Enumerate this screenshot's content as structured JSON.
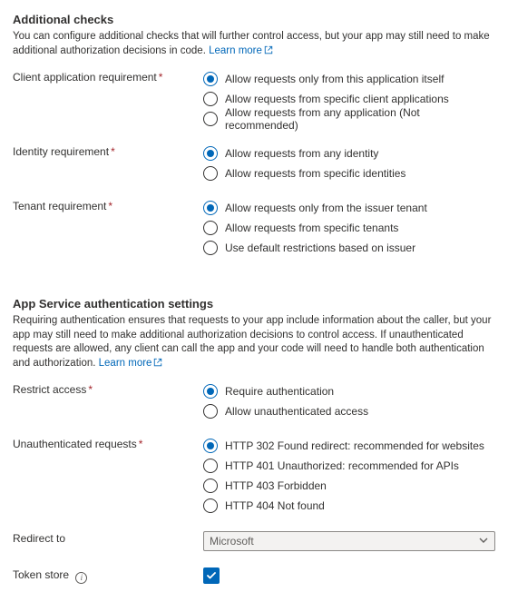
{
  "section1": {
    "title": "Additional checks",
    "desc": "You can configure additional checks that will further control access, but your app may still need to make additional authorization decisions in code.",
    "learn_more": "Learn more"
  },
  "client_req": {
    "label": "Client application requirement",
    "options": [
      "Allow requests only from this application itself",
      "Allow requests from specific client applications",
      "Allow requests from any application (Not recommended)"
    ]
  },
  "identity_req": {
    "label": "Identity requirement",
    "options": [
      "Allow requests from any identity",
      "Allow requests from specific identities"
    ]
  },
  "tenant_req": {
    "label": "Tenant requirement",
    "options": [
      "Allow requests only from the issuer tenant",
      "Allow requests from specific tenants",
      "Use default restrictions based on issuer"
    ]
  },
  "section2": {
    "title": "App Service authentication settings",
    "desc": "Requiring authentication ensures that requests to your app include information about the caller, but your app may still need to make additional authorization decisions to control access. If unauthenticated requests are allowed, any client can call the app and your code will need to handle both authentication and authorization.",
    "learn_more": "Learn more"
  },
  "restrict": {
    "label": "Restrict access",
    "options": [
      "Require authentication",
      "Allow unauthenticated access"
    ]
  },
  "unauth": {
    "label": "Unauthenticated requests",
    "options": [
      "HTTP 302 Found redirect: recommended for websites",
      "HTTP 401 Unauthorized: recommended for APIs",
      "HTTP 403 Forbidden",
      "HTTP 404 Not found"
    ]
  },
  "redirect": {
    "label": "Redirect to",
    "value": "Microsoft"
  },
  "token_store": {
    "label": "Token store"
  }
}
